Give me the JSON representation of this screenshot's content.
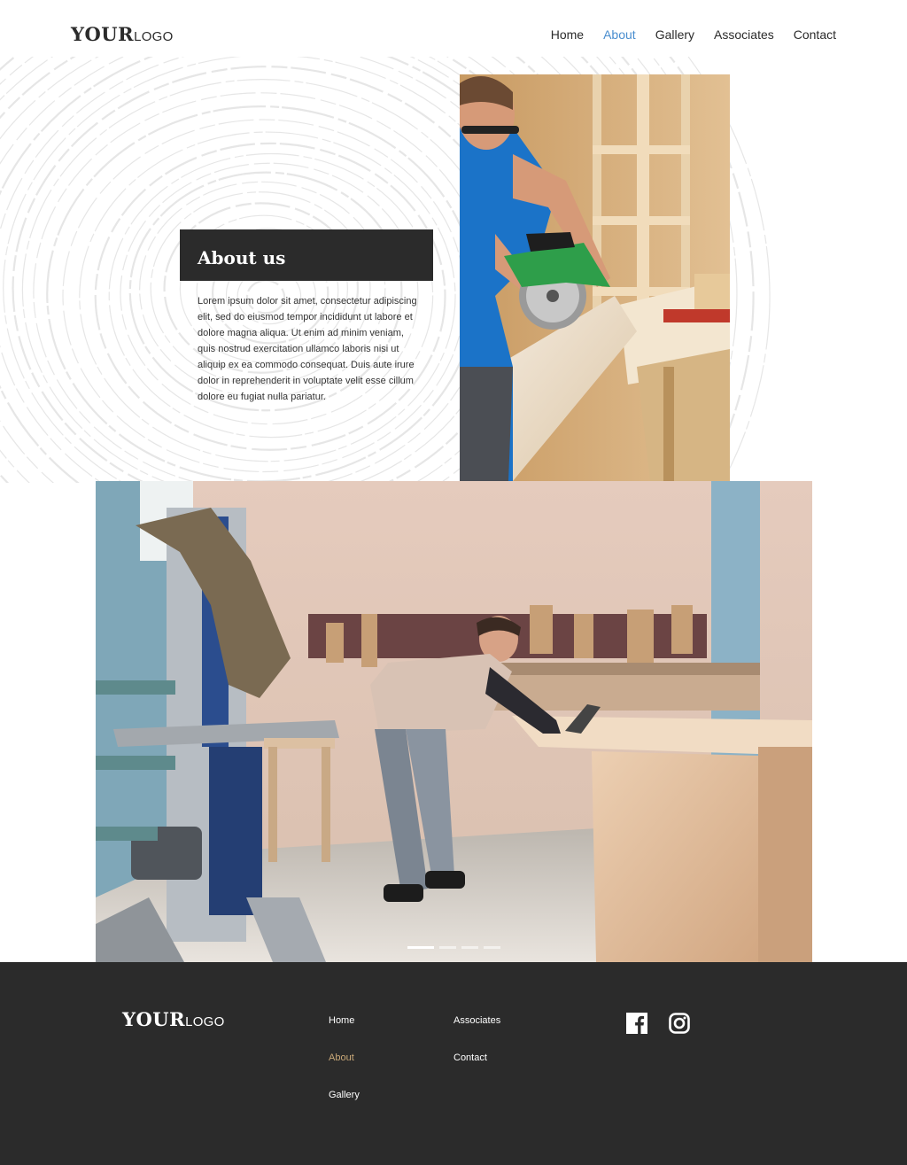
{
  "header": {
    "logo_strong": "YOUR",
    "logo_light": "LOGO",
    "nav": [
      {
        "label": "Home",
        "active": false
      },
      {
        "label": "About",
        "active": true
      },
      {
        "label": "Gallery",
        "active": false
      },
      {
        "label": "Associates",
        "active": false
      },
      {
        "label": "Contact",
        "active": false
      }
    ]
  },
  "about": {
    "title": "About us",
    "body": "Lorem ipsum dolor sit amet, consectetur adipiscing elit, sed do eiusmod tempor incididunt ut labore et dolore magna aliqua. Ut enim ad minim veniam, quis nostrud exercitation ullamco laboris nisi ut aliquip ex ea commodo consequat. Duis aute irure dolor in reprehenderit in voluptate velit esse cillum dolore eu fugiat nulla pariatur."
  },
  "images": {
    "top_photo": "carpenter-with-circular-saw",
    "main_photo": "carpenter-workshop"
  },
  "slider": {
    "slide_count": 4,
    "active_index": 0
  },
  "footer": {
    "logo_strong": "YOUR",
    "logo_light": "LOGO",
    "links_col1": [
      {
        "label": "Home",
        "active": false
      },
      {
        "label": "About",
        "active": true
      },
      {
        "label": "Gallery",
        "active": false
      }
    ],
    "links_col2": [
      {
        "label": "Associates",
        "active": false
      },
      {
        "label": "Contact",
        "active": false
      }
    ],
    "social": [
      "facebook-icon",
      "instagram-icon"
    ]
  },
  "colors": {
    "accent": "#4a8ecf",
    "footer_bg": "#2b2b2b",
    "footer_active": "#c9a878",
    "title_box": "#2b2b2b"
  }
}
